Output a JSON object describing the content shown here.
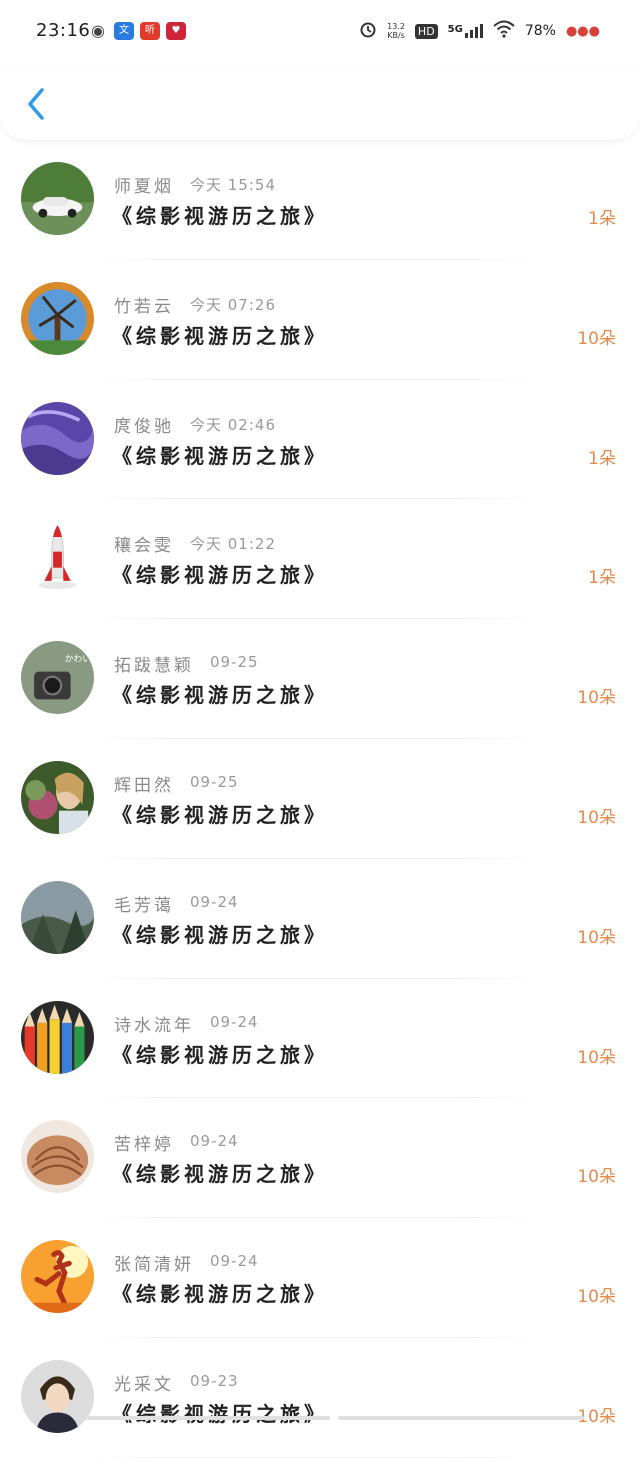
{
  "status_bar": {
    "time": "23:16",
    "apps": [
      {
        "icon": "wechat-icon",
        "glyph": "◉",
        "color": "#444444"
      },
      {
        "icon": "translate-app-icon",
        "glyph": "文",
        "color": "#2a7be0"
      },
      {
        "icon": "listen-app-icon",
        "glyph": "听",
        "color": "#e03a2a"
      },
      {
        "icon": "shop-app-icon",
        "glyph": "♥",
        "color": "#d0243a"
      }
    ],
    "net_speed": "13.2\nKB/s",
    "hd": "HD",
    "network": "5G",
    "battery": "78%"
  },
  "header": {
    "back_icon": "chevron-left-icon",
    "accent": "#2b9be8"
  },
  "colors": {
    "amount": "#e8894a",
    "name": "#8a8a8a",
    "title": "#222222"
  },
  "list": [
    {
      "name": "师夏烟",
      "time": "今天 15:54",
      "title": "《综影视游历之旅》",
      "amount": "1朵",
      "avatar": "car"
    },
    {
      "name": "竹若云",
      "time": "今天 07:26",
      "title": "《综影视游历之旅》",
      "amount": "10朵",
      "avatar": "windmill"
    },
    {
      "name": "庹俊驰",
      "time": "今天 02:46",
      "title": "《综影视游历之旅》",
      "amount": "1朵",
      "avatar": "purple"
    },
    {
      "name": "穰会雯",
      "time": "今天 01:22",
      "title": "《综影视游历之旅》",
      "amount": "1朵",
      "avatar": "rocket"
    },
    {
      "name": "拓跋慧颖",
      "time": "09-25",
      "title": "《综影视游历之旅》",
      "amount": "10朵",
      "avatar": "camera"
    },
    {
      "name": "辉田然",
      "time": "09-25",
      "title": "《综影视游历之旅》",
      "amount": "10朵",
      "avatar": "girl"
    },
    {
      "name": "毛芳蔼",
      "time": "09-24",
      "title": "《综影视游历之旅》",
      "amount": "10朵",
      "avatar": "forest"
    },
    {
      "name": "诗水流年",
      "time": "09-24",
      "title": "《综影视游历之旅》",
      "amount": "10朵",
      "avatar": "pencils"
    },
    {
      "name": "苦梓婷",
      "time": "09-24",
      "title": "《综影视游历之旅》",
      "amount": "10朵",
      "avatar": "shell"
    },
    {
      "name": "张简清妍",
      "time": "09-24",
      "title": "《综影视游历之旅》",
      "amount": "10朵",
      "avatar": "runner"
    },
    {
      "name": "光采文",
      "time": "09-23",
      "title": "《综影视游历之旅》",
      "amount": "10朵",
      "avatar": "boy"
    }
  ]
}
